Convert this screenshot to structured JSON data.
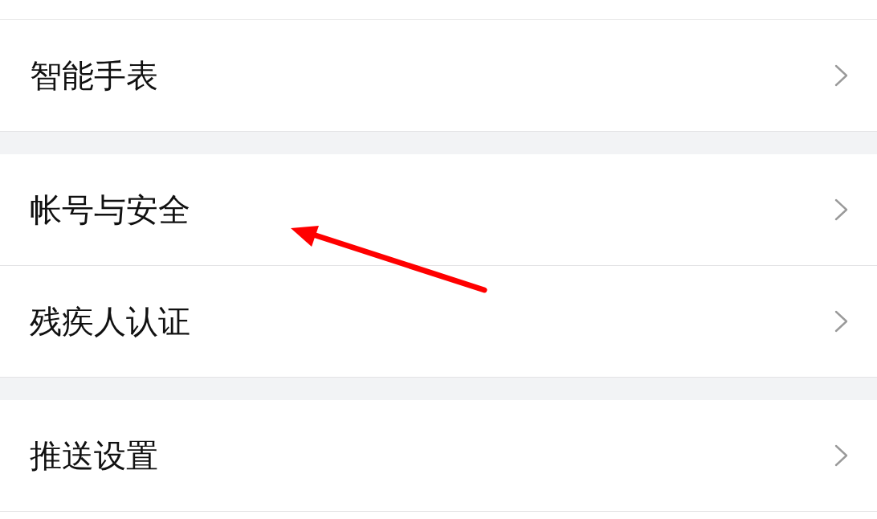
{
  "settings_groups": [
    {
      "items": [
        {
          "label": "智能手表",
          "pointed_at": false
        }
      ]
    },
    {
      "items": [
        {
          "label": "帐号与安全",
          "pointed_at": true
        },
        {
          "label": "残疾人认证",
          "pointed_at": false
        }
      ]
    },
    {
      "items": [
        {
          "label": "推送设置",
          "pointed_at": false
        }
      ]
    }
  ]
}
